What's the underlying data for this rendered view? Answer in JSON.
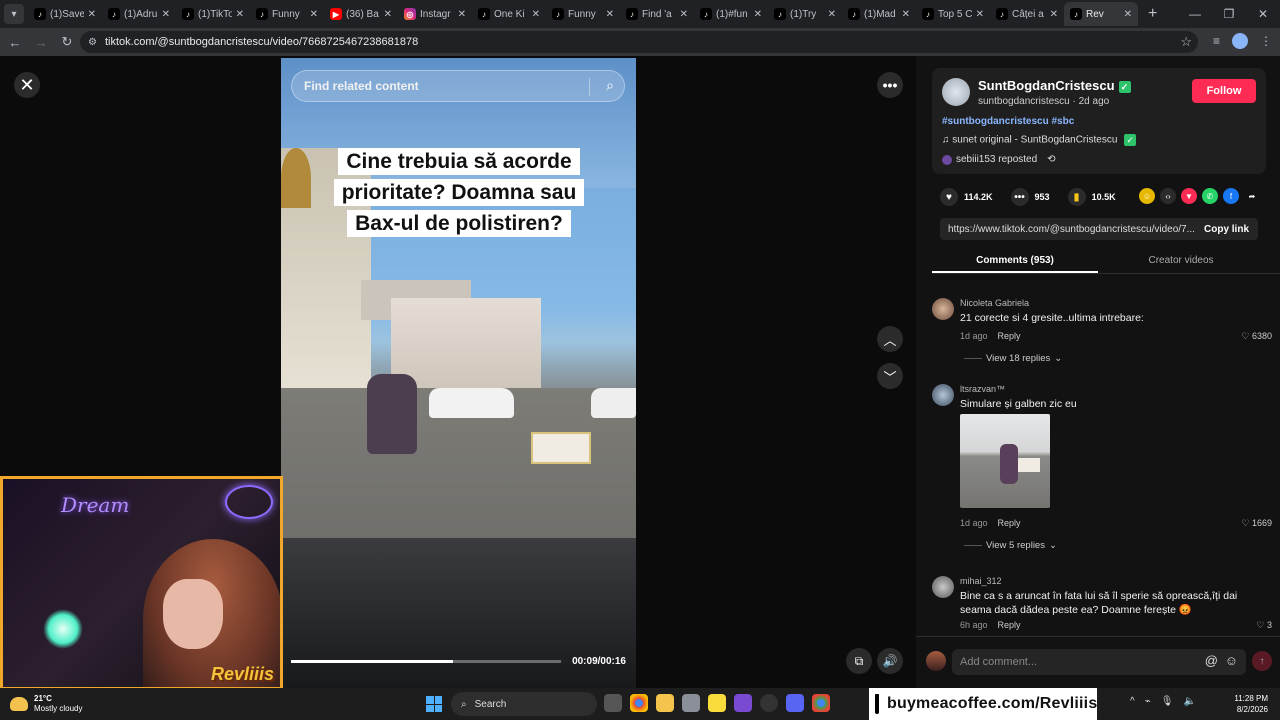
{
  "browser": {
    "tabs": [
      {
        "title": "(1)Save",
        "icon": "tiktok-icon"
      },
      {
        "title": "(1)Adru",
        "icon": "tiktok-icon"
      },
      {
        "title": "(1)TikTo",
        "icon": "tiktok-icon"
      },
      {
        "title": "Funny",
        "icon": "tiktok-icon"
      },
      {
        "title": "(36) Ba",
        "icon": "youtube-icon"
      },
      {
        "title": "Instagr",
        "icon": "instagram-icon"
      },
      {
        "title": "One Ki",
        "icon": "tiktok-icon"
      },
      {
        "title": "Funny",
        "icon": "tiktok-icon"
      },
      {
        "title": "Find 'a",
        "icon": "tiktok-icon"
      },
      {
        "title": "(1)#fun",
        "icon": "tiktok-icon"
      },
      {
        "title": "(1)Try",
        "icon": "tiktok-icon"
      },
      {
        "title": "(1)Mad",
        "icon": "tiktok-icon"
      },
      {
        "title": "Top 5 C",
        "icon": "tiktok-icon"
      },
      {
        "title": "Câței a",
        "icon": "tiktok-icon"
      },
      {
        "title": "Rev",
        "icon": "tiktok-icon",
        "active": true
      }
    ],
    "url": "tiktok.com/@suntbogdancristescu/video/7668725467238681878"
  },
  "video": {
    "search_placeholder": "Find related content",
    "caption": "Cine trebuia să acorde prioritate? Doamna sau Bax-ul de polistiren?",
    "timecode": "00:09/00:16",
    "progress": 0.6
  },
  "post": {
    "username": "SuntBogdanCristescu",
    "handle_line": "suntbogdancristescu · 2d ago",
    "follow_label": "Follow",
    "hashtags": "#suntbogdancristescu #sbc",
    "sound": "sunet original - SuntBogdanCristescu",
    "repost": "sebiii153 reposted",
    "likes": "114.2K",
    "comments_count": "953",
    "saves": "10.5K",
    "link": "https://www.tiktok.com/@suntbogdancristescu/video/7...",
    "copy_label": "Copy link"
  },
  "panel_tabs": [
    "Comments (953)",
    "Creator videos"
  ],
  "comments": [
    {
      "name": "Nicoleta Gabriela",
      "text": "21 corecte si 4 gresite..ultima intrebare:",
      "time": "1d ago",
      "reply": "Reply",
      "likes": "6380",
      "replies": "View 18 replies"
    },
    {
      "name": "ltsrazvan™",
      "text": "Simulare și galben zic eu",
      "time": "1d ago",
      "reply": "Reply",
      "likes": "1669",
      "replies": "View 5 replies"
    },
    {
      "name": "mihai_312",
      "text": "Bine ca s a aruncat în fata lui să îl sperie să oprească,îți dai seama dacă dădea peste ea? Doamne ferește 😡",
      "time": "6h ago",
      "reply": "Reply",
      "likes": "3"
    }
  ],
  "add_comment_placeholder": "Add comment...",
  "overlay": {
    "neon_sign": "Dream",
    "streamer_name": "Revliiis"
  },
  "taskbar": {
    "temp": "21°C",
    "weather": "Mostly cloudy",
    "search": "Search",
    "coffee": "buymeacoffee.com/Revliiis",
    "time": "11:28 PM",
    "date": "8/2/2026"
  },
  "colors": {
    "follow": "#fe2c55",
    "tiktok_bg": "#121212",
    "taskbar": "#1d1d1d",
    "overlay_border": "#f1a82a"
  }
}
